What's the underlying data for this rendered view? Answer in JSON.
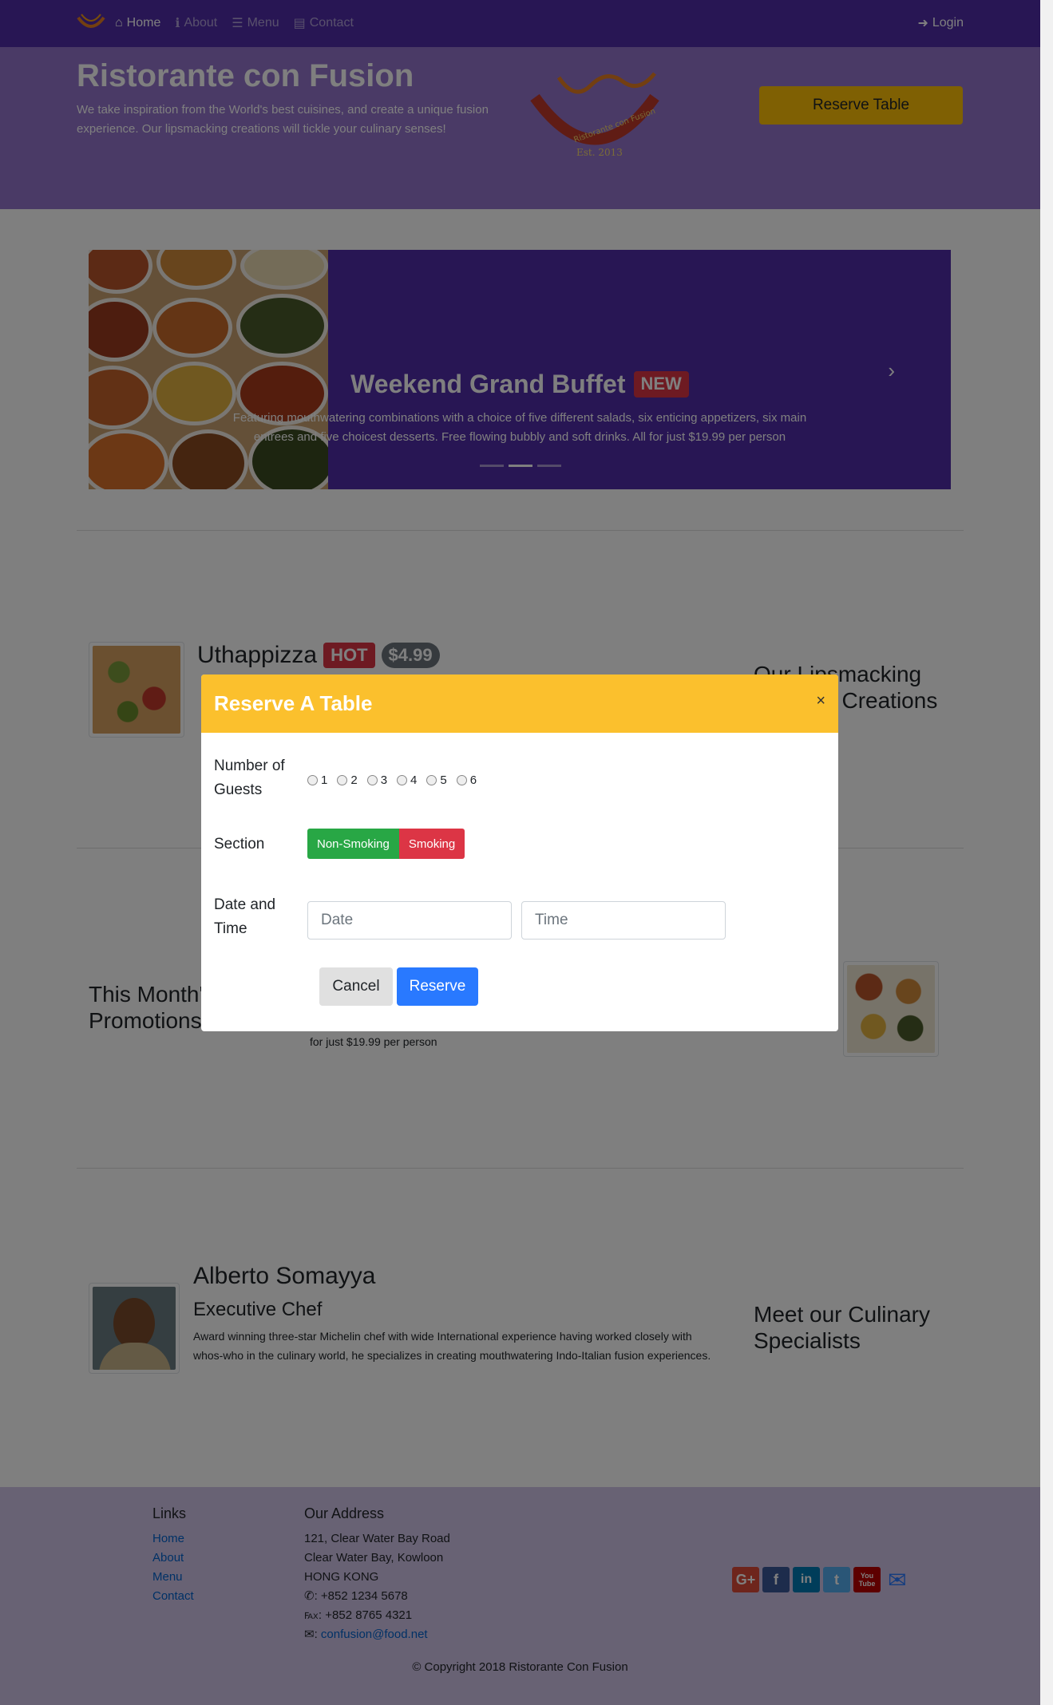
{
  "navbar": {
    "items": [
      {
        "icon": "home-icon",
        "label": "Home"
      },
      {
        "icon": "info-icon",
        "label": "About"
      },
      {
        "icon": "list-icon",
        "label": "Menu"
      },
      {
        "icon": "address-card-icon",
        "label": "Contact"
      }
    ],
    "login_label": "Login"
  },
  "jumbotron": {
    "title": "Ristorante con Fusion",
    "text": "We take inspiration from the World's best cuisines, and create a unique fusion experience. Our lipsmacking creations will tickle your culinary senses!",
    "logo_text": "Ristorante con Fusion",
    "logo_est": "Est. 2013",
    "button_label": "Reserve Table"
  },
  "carousel": {
    "title": "Weekend Grand Buffet",
    "badge": "NEW",
    "text": "Featuring mouthwatering combinations with a choice of five different salads, six enticing appetizers, six main entrees and five choicest desserts. Free flowing bubbly and soft drinks. All for just $19.99 per person"
  },
  "dish": {
    "name": "Uthappizza",
    "badge_hot": "HOT",
    "badge_price": "$4.99",
    "side_heading": "Our Lipsmacking Culinary Creations"
  },
  "promotion": {
    "side_heading": "This Month's Promotions",
    "trailing_text": "for just $19.99 per person"
  },
  "leader": {
    "name": "Alberto Somayya",
    "title": "Executive Chef",
    "text": "Award winning three-star Michelin chef with wide International experience having worked closely with whos-who in the culinary world, he specializes in creating mouthwatering Indo-Italian fusion experiences.",
    "side_heading": "Meet our Culinary Specialists"
  },
  "footer": {
    "links_heading": "Links",
    "links": [
      "Home",
      "About",
      "Menu",
      "Contact"
    ],
    "address_heading": "Our Address",
    "address": [
      "121, Clear Water Bay Road",
      "Clear Water Bay, Kowloon",
      "HONG KONG"
    ],
    "phone": ": +852 1234 5678",
    "fax": ": +852 8765 4321",
    "email": "confusion@food.net",
    "socials": [
      {
        "icon": "google-plus-icon",
        "glyph": "G+",
        "color": "#dd4b39"
      },
      {
        "icon": "facebook-icon",
        "glyph": "f",
        "color": "#3b5998"
      },
      {
        "icon": "linkedin-icon",
        "glyph": "in",
        "color": "#007bb5"
      },
      {
        "icon": "twitter-icon",
        "glyph": "t",
        "color": "#55acee"
      },
      {
        "icon": "youtube-icon",
        "glyph": "You Tube",
        "color": "#bb0000"
      }
    ],
    "copyright": "© Copyright 2018 Ristorante Con Fusion"
  },
  "modal": {
    "title": "Reserve A Table",
    "close": "×",
    "guests_label": "Number of Guests",
    "guests_options": [
      "1",
      "2",
      "3",
      "4",
      "5",
      "6"
    ],
    "section_label": "Section",
    "section_options": [
      "Non-Smoking",
      "Smoking"
    ],
    "datetime_label": "Date and Time",
    "date_placeholder": "Date",
    "time_placeholder": "Time",
    "cancel_label": "Cancel",
    "reserve_label": "Reserve"
  }
}
